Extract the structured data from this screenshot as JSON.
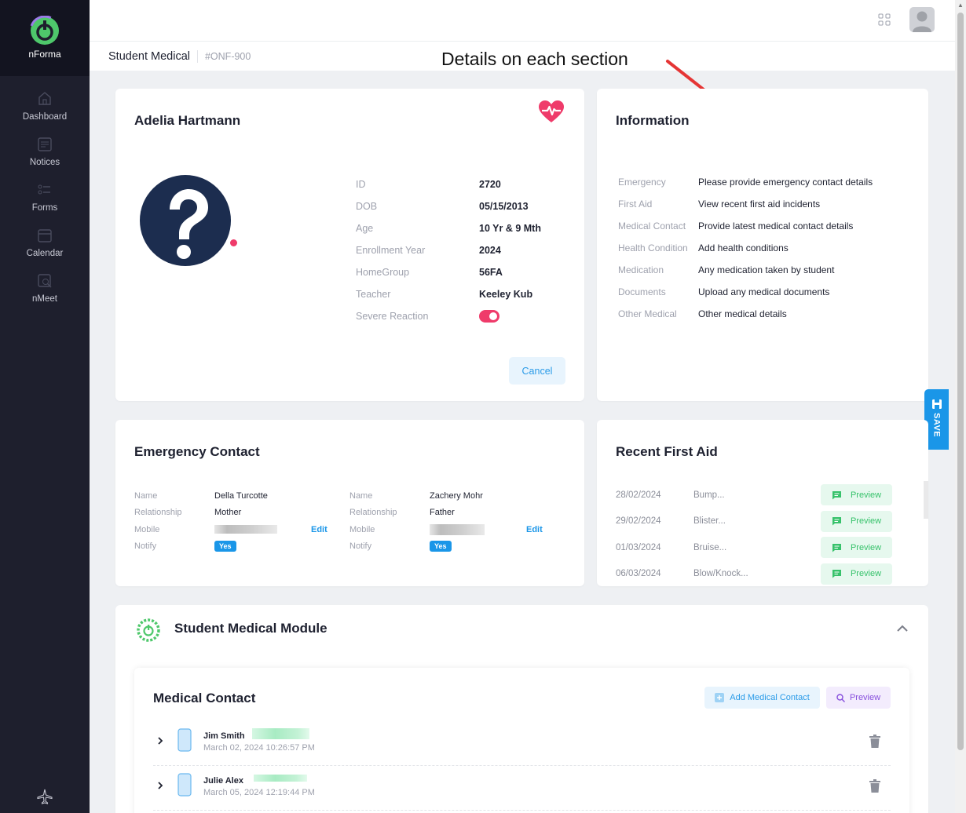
{
  "brand": {
    "name": "nForma"
  },
  "nav": [
    {
      "label": "Dashboard",
      "icon": "home-icon"
    },
    {
      "label": "Notices",
      "icon": "notices-icon"
    },
    {
      "label": "Forms",
      "icon": "forms-icon"
    },
    {
      "label": "Calendar",
      "icon": "calendar-icon"
    },
    {
      "label": "nMeet",
      "icon": "nmeet-icon"
    }
  ],
  "header": {
    "title": "Student Medical",
    "code": "#ONF-900"
  },
  "annotation": {
    "text": "Details on each section"
  },
  "student": {
    "name": "Adelia Hartmann",
    "fields": [
      {
        "label": "ID",
        "value": "2720"
      },
      {
        "label": "DOB",
        "value": "05/15/2013"
      },
      {
        "label": "Age",
        "value": "10 Yr & 9 Mth"
      },
      {
        "label": "Enrollment Year",
        "value": "2024"
      },
      {
        "label": "HomeGroup",
        "value": "56FA"
      },
      {
        "label": "Teacher",
        "value": "Keeley Kub"
      }
    ],
    "severe_reaction_label": "Severe Reaction",
    "severe_reaction": true,
    "cancel_label": "Cancel"
  },
  "information": {
    "title": "Information",
    "rows": [
      {
        "label": "Emergency",
        "value": "Please provide emergency contact details"
      },
      {
        "label": "First Aid",
        "value": "View recent first aid incidents"
      },
      {
        "label": "Medical Contact",
        "value": "Provide latest medical contact details"
      },
      {
        "label": "Health Condition",
        "value": "Add health conditions"
      },
      {
        "label": "Medication",
        "value": "Any medication taken by student"
      },
      {
        "label": "Documents",
        "value": "Upload any medical documents"
      },
      {
        "label": "Other Medical",
        "value": "Other medical details"
      }
    ]
  },
  "save": {
    "label": "SAVE"
  },
  "emergency": {
    "title": "Emergency Contact",
    "labels": {
      "name": "Name",
      "relationship": "Relationship",
      "mobile": "Mobile",
      "notify": "Notify"
    },
    "edit_label": "Edit",
    "contacts": [
      {
        "name": "Della Turcotte",
        "relationship": "Mother",
        "notify": "Yes"
      },
      {
        "name": "Zachery Mohr",
        "relationship": "Father",
        "notify": "Yes"
      }
    ]
  },
  "first_aid": {
    "title": "Recent First Aid",
    "preview_label": "Preview",
    "items": [
      {
        "date": "28/02/2024",
        "desc": "Bump..."
      },
      {
        "date": "29/02/2024",
        "desc": "Blister..."
      },
      {
        "date": "01/03/2024",
        "desc": "Bruise..."
      },
      {
        "date": "06/03/2024",
        "desc": "Blow/Knock..."
      }
    ]
  },
  "module": {
    "title": "Student Medical Module",
    "medical_contact": {
      "title": "Medical Contact",
      "add_label": "Add Medical Contact",
      "preview_label": "Preview",
      "rows": [
        {
          "name": "Jim Smith",
          "date": "March 02, 2024 10:26:57 PM"
        },
        {
          "name": "Julie Alex",
          "date": "March 05, 2024 12:19:44 PM"
        }
      ]
    }
  },
  "colors": {
    "accent": "#1a96e8",
    "danger": "#ef3b6a",
    "success": "#37c26b",
    "sidebar": "#1e1f2d"
  }
}
